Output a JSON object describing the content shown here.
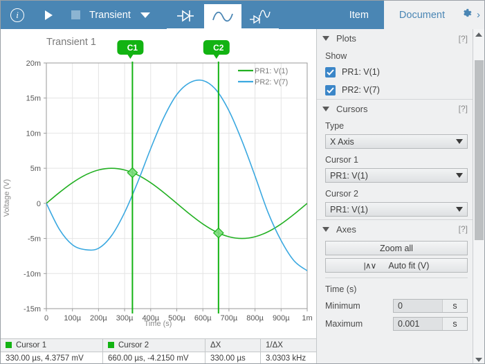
{
  "toolbar": {
    "info_icon": "info-circle-icon",
    "play_icon": "play-icon",
    "stop_icon": "stop-icon",
    "analysis_label": "Transient",
    "dropdown_icon": "caret-down-icon",
    "icon_tabs": [
      {
        "name": "dc-sweep-tab",
        "icon": "diode-dc-icon",
        "active": false
      },
      {
        "name": "transient-tab",
        "icon": "sine-wave-icon",
        "active": true
      },
      {
        "name": "ac-analysis-tab",
        "icon": "diode-ac-icon",
        "active": false
      }
    ],
    "mode_tabs": [
      {
        "label": "Item",
        "selected": true
      },
      {
        "label": "Document",
        "selected": false
      }
    ],
    "gear_icon": "gear-icon",
    "expand_icon": "chevron-right-icon",
    "accent_color": "#4a86b4"
  },
  "chart_data": {
    "type": "line",
    "title": "Transient 1",
    "xlabel": "Time (s)",
    "ylabel": "Voltage (V)",
    "xlim": [
      0,
      0.001
    ],
    "ylim": [
      -0.015,
      0.02
    ],
    "grid": true,
    "legend_position": "top-right",
    "xticks": [
      0,
      0.0001,
      0.0002,
      0.0003,
      0.0004,
      0.0005,
      0.0006,
      0.0007,
      0.0008,
      0.0009,
      0.001
    ],
    "xticklabels": [
      "0",
      "100µ",
      "200µ",
      "300µ",
      "400µ",
      "500µ",
      "600µ",
      "700µ",
      "800µ",
      "900µ",
      "1m"
    ],
    "yticks": [
      0.02,
      0.015,
      0.01,
      0.005,
      0,
      -0.005,
      -0.01,
      -0.015
    ],
    "yticklabels": [
      "20m",
      "15m",
      "10m",
      "5m",
      "0",
      "-5m",
      "-10m",
      "-15m"
    ],
    "series": [
      {
        "name": "PR1: V(1)",
        "color": "#22b022",
        "amplitude_v": 0.005,
        "period_s": 0.001,
        "phase_deg": 0,
        "points_t_us": [
          0,
          50,
          100,
          150,
          200,
          250,
          300,
          350,
          400,
          450,
          500,
          550,
          600,
          650,
          700,
          750,
          800,
          850,
          900,
          950,
          1000
        ],
        "points_v_mv": [
          0,
          1.545,
          2.939,
          4.045,
          4.755,
          5.0,
          4.755,
          4.045,
          2.939,
          1.545,
          0,
          -1.545,
          -2.939,
          -4.045,
          -4.755,
          -5.0,
          -4.755,
          -4.045,
          -2.939,
          -1.545,
          0
        ]
      },
      {
        "name": "PR2: V(7)",
        "color": "#3aa8e0",
        "amplitude_v": 0.0175,
        "period_s": 0.000905,
        "phase_deg": 180,
        "points_t_us": [
          0,
          50,
          100,
          150,
          200,
          250,
          300,
          350,
          400,
          450,
          500,
          550,
          600,
          650,
          700,
          750,
          800,
          850,
          900,
          950,
          1000
        ],
        "points_v_mv": [
          0,
          -3.7,
          -5.9,
          -6.6,
          -6.4,
          -4.6,
          -1.3,
          3.0,
          7.8,
          12.2,
          15.5,
          17.2,
          17.5,
          16.2,
          13.2,
          8.9,
          3.9,
          -1.3,
          -5.3,
          -8.2,
          -9.6
        ]
      }
    ],
    "cursors": [
      {
        "label": "C1",
        "x_us": 330,
        "y_mv": 4.3757,
        "color": "#12b312"
      },
      {
        "label": "C2",
        "x_us": 660,
        "y_mv": -4.215,
        "color": "#12b312"
      }
    ]
  },
  "panel": {
    "plots": {
      "title": "Plots",
      "help": "[?]",
      "collapse_icon": "triangle-down-icon",
      "show_label": "Show",
      "items": [
        {
          "label": "PR1: V(1)",
          "checked": true
        },
        {
          "label": "PR2: V(7)",
          "checked": true
        }
      ]
    },
    "cursors": {
      "title": "Cursors",
      "help": "[?]",
      "collapse_icon": "triangle-down-icon",
      "type_label": "Type",
      "type_value": "X Axis",
      "cursor1_label": "Cursor 1",
      "cursor1_value": "PR1: V(1)",
      "cursor2_label": "Cursor 2",
      "cursor2_value": "PR1: V(1)"
    },
    "axes": {
      "title": "Axes",
      "help": "[?]",
      "collapse_icon": "triangle-down-icon",
      "zoom_all_label": "Zoom all",
      "auto_fit_label": "Auto fit (V)",
      "auto_fit_icon": "waveform-icon",
      "time_label": "Time (s)",
      "minimum_label": "Minimum",
      "minimum_value": "0",
      "minimum_unit": "s",
      "maximum_label": "Maximum",
      "maximum_value": "0.001",
      "maximum_unit": "s"
    }
  },
  "cursor_table": {
    "headers": [
      "Cursor 1",
      "Cursor 2",
      "ΔX",
      "1/ΔX"
    ],
    "values": [
      "330.00 µs, 4.3757 mV",
      "660.00 µs, -4.2150 mV",
      "330.00 µs",
      "3.0303 kHz"
    ],
    "swatch_color": "#12b312"
  },
  "scrollbar": {
    "up_icon": "scroll-up-icon",
    "down_icon": "scroll-down-icon",
    "thumb": "scroll-thumb"
  }
}
